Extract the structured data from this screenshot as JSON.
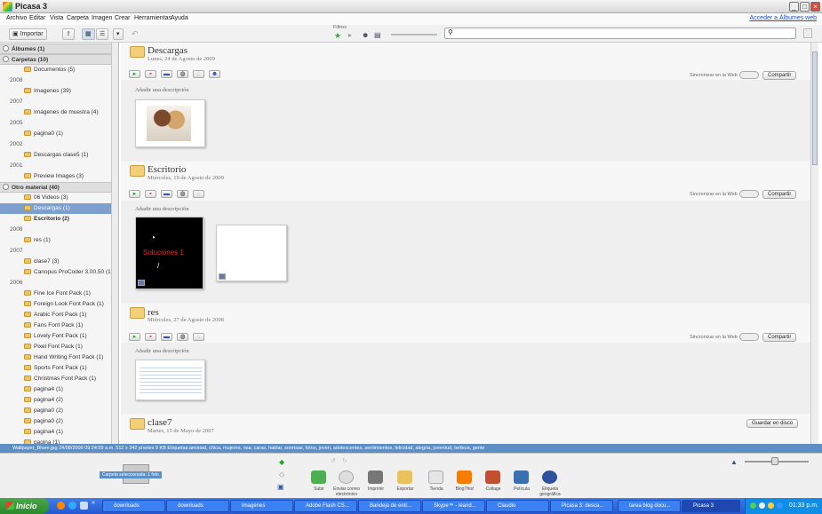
{
  "window": {
    "title": "Picasa 3"
  },
  "menu": {
    "items": [
      "Archivo",
      "Editar",
      "Vista",
      "Carpeta",
      "Imagen",
      "Crear",
      "Herramientas",
      "Ayuda"
    ],
    "web_link": "Acceder a Álbumes web"
  },
  "toolbar": {
    "import_label": "Importar",
    "filter_label": "Filtros"
  },
  "sidebar": {
    "rows": [
      {
        "kind": "header",
        "label": "Álbumes (1)"
      },
      {
        "kind": "header",
        "label": "Carpetas (10)"
      },
      {
        "kind": "folder",
        "label": "Documentos (5)"
      },
      {
        "kind": "year",
        "label": "2008"
      },
      {
        "kind": "folder",
        "label": "Imagenes (39)"
      },
      {
        "kind": "year",
        "label": "2007"
      },
      {
        "kind": "folder",
        "label": "Imágenes de muestra (4)"
      },
      {
        "kind": "year",
        "label": "2005"
      },
      {
        "kind": "folder",
        "label": "pagina0 (1)"
      },
      {
        "kind": "year",
        "label": "2002"
      },
      {
        "kind": "folder",
        "label": "Descargas clase5 (1)"
      },
      {
        "kind": "year",
        "label": "2001"
      },
      {
        "kind": "folder",
        "label": "Preview Images (3)"
      },
      {
        "kind": "header",
        "label": "Otro material (40)"
      },
      {
        "kind": "folder",
        "label": "06 Videos (3)"
      },
      {
        "kind": "folder",
        "label": "Descargas (1)",
        "selected": true
      },
      {
        "kind": "folder",
        "label": "Escritorio (2)",
        "bold": true
      },
      {
        "kind": "year",
        "label": "2008"
      },
      {
        "kind": "folder",
        "label": "res (1)"
      },
      {
        "kind": "year",
        "label": "2007"
      },
      {
        "kind": "folder",
        "label": "clase7 (3)"
      },
      {
        "kind": "folder",
        "label": "Canopus ProCoder 3.00.50 (1)"
      },
      {
        "kind": "year",
        "label": "2006"
      },
      {
        "kind": "folder",
        "label": "Fine Ice Font Pack (1)"
      },
      {
        "kind": "folder",
        "label": "Foreign Look Font Pack (1)"
      },
      {
        "kind": "folder",
        "label": "Arabic Font Pack (1)"
      },
      {
        "kind": "folder",
        "label": "Fans Font Pack (1)"
      },
      {
        "kind": "folder",
        "label": "Lovely Font Pack (1)"
      },
      {
        "kind": "folder",
        "label": "Pixel Font Pack (1)"
      },
      {
        "kind": "folder",
        "label": "Hand Writing Font Pack (1)"
      },
      {
        "kind": "folder",
        "label": "Sports Font Pack (1)"
      },
      {
        "kind": "folder",
        "label": "Christmas Font Pack (1)"
      },
      {
        "kind": "folder",
        "label": "pagina4 (1)"
      },
      {
        "kind": "folder",
        "label": "pagina4 (2)"
      },
      {
        "kind": "folder",
        "label": "pagina0 (2)"
      },
      {
        "kind": "folder",
        "label": "pagina0 (2)"
      },
      {
        "kind": "folder",
        "label": "pagina4 (1)"
      },
      {
        "kind": "folder",
        "label": "pagina (1)"
      }
    ]
  },
  "albums": [
    {
      "title": "Descargas",
      "date": "Lunes, 24 de Agosto de 2009",
      "description": "Añadir una descripción",
      "sync_label": "Sincronizar en la Web",
      "share_label": "Compartir"
    },
    {
      "title": "Escritorio",
      "date": "Miércoles, 19 de Agosto de 2009",
      "description": "Añadir una descripción",
      "sync_label": "Sincronizar en la Web",
      "share_label": "Compartir",
      "photo_text": "Soluciones 1"
    },
    {
      "title": "res",
      "date": "Miércoles, 27 de Agosto de 2008",
      "description": "Añadir una descripción",
      "sync_label": "Sincronizar en la Web",
      "share_label": "Compartir"
    },
    {
      "title": "clase7",
      "date": "Martes, 15 de Mayo de 2007",
      "save_disk_label": "Guardar en disco"
    }
  ],
  "status": {
    "text": "Wallpaper_Bluee.jpg    24/08/2009 09:24:59 a.m.    512 x 342 píxeles    9 KB    Etiquetas:amistad, chica, mujeres, risa, caras, hablar, sonrisas, fotos, joven, adolescentes, sentimientos, felicidad, alegría, juventud, belleza, gente"
  },
  "tray": {
    "selection_label": "Carpeta seleccionada: 1 foto",
    "tools": [
      "Subir",
      "Enviar correo electrónico",
      "Imprimir",
      "Exportar",
      "Tienda",
      "BlogThis!",
      "Collage",
      "Película",
      "Etiqueta geográfica"
    ]
  },
  "taskbar": {
    "start_label": "Inicio",
    "tasks": [
      "downloads",
      "downloads",
      "Imagenes",
      "Adobe Flash CS...",
      "Bandeja de entr...",
      "Skype™ - leand...",
      "Claudio",
      "Picasa 3: desca...",
      "tarea blog docu...",
      "Picasa 3"
    ],
    "clock": "01:33 p.m."
  },
  "colors": {
    "selection": "#7c9fcd",
    "status": "#5e8fc4",
    "taskbar": "#2558d3"
  }
}
